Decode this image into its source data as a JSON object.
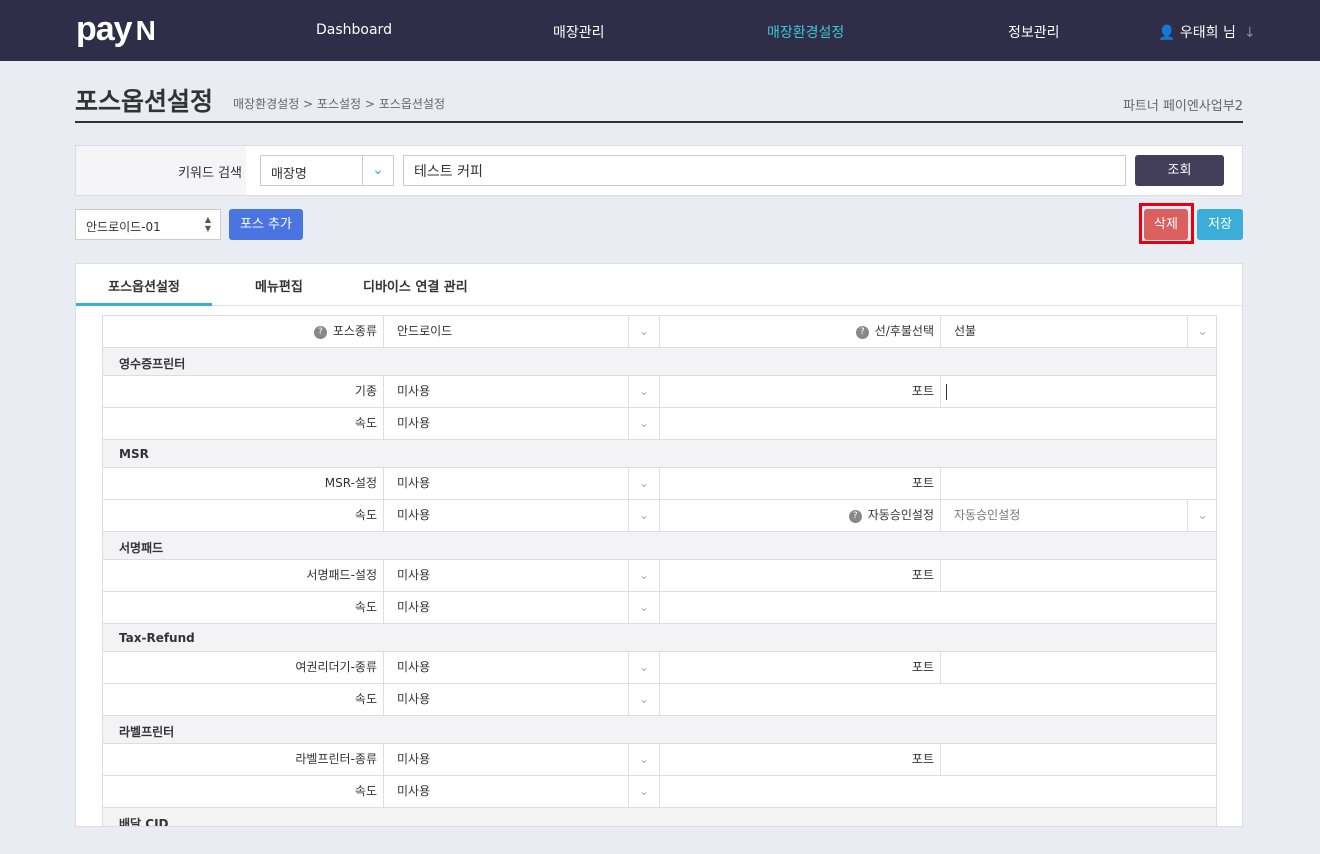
{
  "header": {
    "logo": "pay",
    "logo_mark": "N",
    "nav": [
      "Dashboard",
      "매장관리",
      "매장환경설정",
      "정보관리"
    ],
    "active_nav": "매장환경설정",
    "user": "우태희 님",
    "accent": "#3ec6d8"
  },
  "page": {
    "title": "포스옵션설정",
    "breadcrumb": "매장환경설정 > 포스설정 > 포스옵션설정",
    "dept": "파트너 페이엔사업부2"
  },
  "search": {
    "label": "키워드 검색",
    "type": "매장명",
    "value": "테스트 커피",
    "button": "조회"
  },
  "toolbar": {
    "pos_select": "안드로이드-01",
    "add": "포스 추가",
    "delete": "삭제",
    "save": "저장"
  },
  "tabs": [
    "포스옵션설정",
    "메뉴편집",
    "디바이스 연결 관리"
  ],
  "rows": [
    {
      "l1": "포스종류",
      "q1": true,
      "v1": "안드로이드",
      "l2": "선/후불선택",
      "q2": true,
      "v2": "선불",
      "s2": true
    },
    {
      "section": "영수증프린터"
    },
    {
      "l1": "기종",
      "v1": "미사용",
      "l2": "포트",
      "v2": "",
      "input2": true,
      "cursor": true
    },
    {
      "l1": "속도",
      "v1": "미사용"
    },
    {
      "section": "MSR"
    },
    {
      "l1": "MSR-설정",
      "v1": "미사용",
      "l2": "포트",
      "v2": "",
      "input2": true
    },
    {
      "l1": "속도",
      "v1": "미사용",
      "l2": "자동승인설정",
      "q2": true,
      "v2": "자동승인설정",
      "s2": true,
      "muted2": true
    },
    {
      "section": "서명패드"
    },
    {
      "l1": "서명패드-설정",
      "v1": "미사용",
      "l2": "포트",
      "v2": "",
      "input2": true
    },
    {
      "l1": "속도",
      "v1": "미사용"
    },
    {
      "section": "Tax-Refund"
    },
    {
      "l1": "여권리더기-종류",
      "v1": "미사용",
      "l2": "포트",
      "v2": "",
      "input2": true
    },
    {
      "l1": "속도",
      "v1": "미사용"
    },
    {
      "section": "라벨프린터"
    },
    {
      "l1": "라벨프린터-종류",
      "v1": "미사용",
      "l2": "포트",
      "v2": "",
      "input2": true
    },
    {
      "l1": "속도",
      "v1": "미사용"
    },
    {
      "section": "배달 CID"
    }
  ]
}
